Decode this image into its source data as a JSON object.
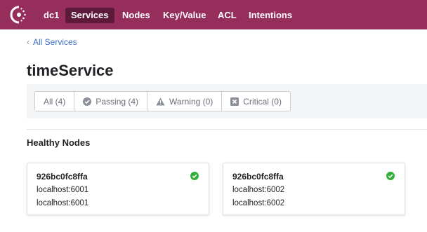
{
  "nav": {
    "items": [
      {
        "label": "dc1"
      },
      {
        "label": "Services"
      },
      {
        "label": "Nodes"
      },
      {
        "label": "Key/Value"
      },
      {
        "label": "ACL"
      },
      {
        "label": "Intentions"
      }
    ],
    "active": "Services"
  },
  "breadcrumb": {
    "label": "All Services"
  },
  "page": {
    "title": "timeService"
  },
  "filters": [
    {
      "label": "All (4)",
      "icon": null,
      "selected": true
    },
    {
      "label": "Passing (4)",
      "icon": "check-circle-icon"
    },
    {
      "label": "Warning (0)",
      "icon": "warning-icon"
    },
    {
      "label": "Critical (0)",
      "icon": "critical-x-icon"
    }
  ],
  "section": {
    "title": "Healthy Nodes"
  },
  "nodes": [
    {
      "name": "926bc0fc8ffa",
      "address1": "localhost:6001",
      "address2": "localhost:6001",
      "status": "passing"
    },
    {
      "name": "926bc0fc8ffa",
      "address1": "localhost:6002",
      "address2": "localhost:6002",
      "status": "passing"
    }
  ],
  "colors": {
    "header": "#962e5c",
    "active_nav": "#5e1a3a",
    "link": "#3b6ec9",
    "passing": "#2eb039"
  }
}
